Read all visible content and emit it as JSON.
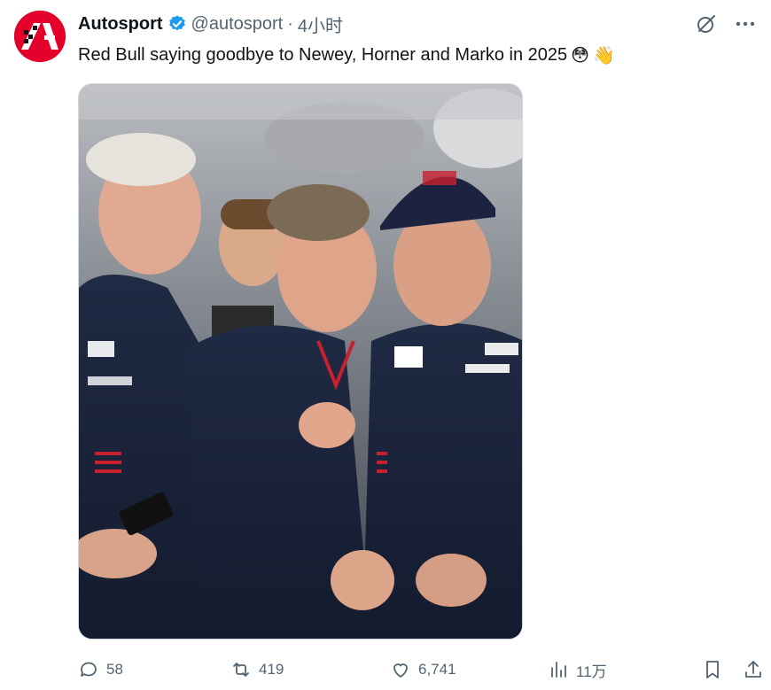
{
  "account": {
    "name": "Autosport",
    "handle": "@autosport",
    "separator": "·",
    "time": "4小时",
    "avatar_icon": "autosport-logo",
    "verified_icon": "verified-badge-icon",
    "brand_color": "#e4002b"
  },
  "tweet": {
    "text": "Red Bull saying goodbye to Newey, Horner and Marko in 2025",
    "emojis": [
      "😳",
      "👋"
    ]
  },
  "top_actions": {
    "grok_icon": "grok-icon",
    "more_icon": "more-dots-icon"
  },
  "stats": {
    "replies": "58",
    "retweets": "419",
    "likes": "6,741",
    "views": "11万"
  },
  "colors": {
    "text": "#0f1419",
    "secondary": "#536471",
    "verified": "#1d9bf0",
    "border": "#cfd9de"
  }
}
